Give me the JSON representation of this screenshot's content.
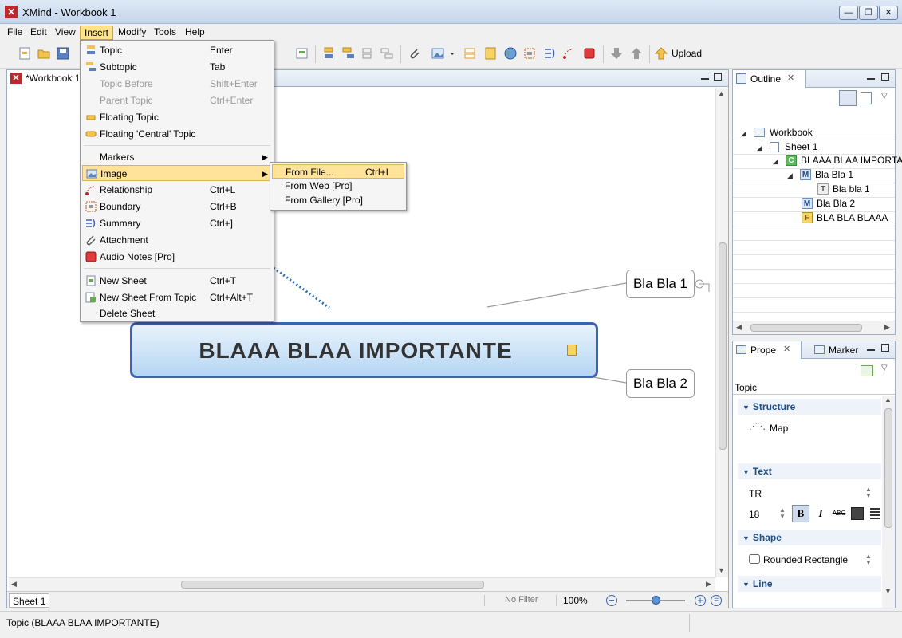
{
  "window": {
    "title": "XMind - Workbook 1",
    "icon": "xmind-logo-icon",
    "min_label": "—",
    "max_label": "❐",
    "close_label": "✕"
  },
  "menubar": [
    "File",
    "Edit",
    "View",
    "Insert",
    "Modify",
    "Tools",
    "Help"
  ],
  "toolbar": {
    "upload_label": "Upload"
  },
  "editor": {
    "tab_label": "*Workbook 1",
    "sheet_tab": "Sheet 1",
    "filter": "No Filter",
    "zoom": "100%"
  },
  "mindmap": {
    "central": "BLAAA BLAA IMPORTANTE",
    "subtopic1": "Bla Bla 1",
    "subtopic2": "Bla Bla 2"
  },
  "insert_menu": {
    "topic": "Topic",
    "topic_sc": "Enter",
    "subtopic": "Subtopic",
    "subtopic_sc": "Tab",
    "topic_before": "Topic Before",
    "topic_before_sc": "Shift+Enter",
    "parent_topic": "Parent Topic",
    "parent_topic_sc": "Ctrl+Enter",
    "floating_topic": "Floating Topic",
    "floating_central": "Floating 'Central' Topic",
    "markers": "Markers",
    "image": "Image",
    "relationship": "Relationship",
    "relationship_sc": "Ctrl+L",
    "boundary": "Boundary",
    "boundary_sc": "Ctrl+B",
    "summary": "Summary",
    "summary_sc": "Ctrl+]",
    "attachment": "Attachment",
    "audio_notes": "Audio Notes [Pro]",
    "new_sheet": "New Sheet",
    "new_sheet_sc": "Ctrl+T",
    "new_sheet_from_topic": "New Sheet From Topic",
    "new_sheet_from_topic_sc": "Ctrl+Alt+T",
    "delete_sheet": "Delete Sheet"
  },
  "image_submenu": {
    "from_file": "From File...",
    "from_file_sc": "Ctrl+I",
    "from_web": "From Web [Pro]",
    "from_gallery": "From Gallery [Pro]"
  },
  "outline": {
    "tab": "Outline",
    "rows": [
      "Workbook",
      "Sheet 1",
      "BLAAA BLAA IMPORTANTE",
      "Bla Bla 1",
      "Bla bla 1",
      "Bla Bla 2",
      "BLA BLA BLAAA"
    ],
    "badges": [
      "",
      "",
      "C",
      "M",
      "T",
      "M",
      "F"
    ]
  },
  "properties": {
    "tab": "Prope",
    "marker_tab": "Marker",
    "heading": "Topic",
    "structure_label": "Structure",
    "structure_value": "Map",
    "text_label": "Text",
    "font_name": "TR",
    "font_size": "18",
    "bold": "B",
    "italic": "I",
    "strike": "ABC",
    "shape_label": "Shape",
    "shape_value": "Rounded Rectangle",
    "line_label": "Line"
  },
  "statusbar": {
    "text": "Topic (BLAAA BLAA IMPORTANTE)"
  },
  "colors": {
    "accent": "#3c63b3",
    "menu_highlight": "#ffe39a",
    "brand": "#c0272d"
  }
}
